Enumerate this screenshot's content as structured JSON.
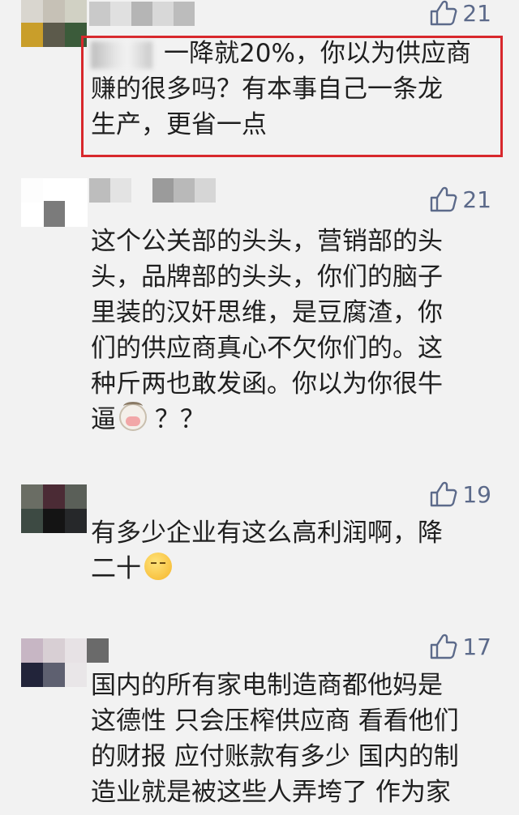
{
  "comments": [
    {
      "likes": "21",
      "lines": [
        "一降就20%，你以为供应商",
        "赚的很多吗？有本事自己一条龙",
        "生产，更省一点"
      ]
    },
    {
      "likes": "21",
      "lines": [
        "这个公关部的头头，营销部的头",
        "头，品牌部的头头，你们的脑子",
        "里装的汉奸思维，是豆腐渣，你",
        "们的供应商真心不欠你们的。这",
        "种斤两也敢发函。你以为你很牛",
        "逼",
        "？？"
      ]
    },
    {
      "likes": "19",
      "lines": [
        "有多少企业有这么高利润啊，降",
        "二十"
      ]
    },
    {
      "likes": "17",
      "lines": [
        "国内的所有家电制造商都他妈是",
        "这德性 只会压榨供应商 看看他们",
        "的财报 应付账款有多少 国内的制",
        "造业就是被这些人弄垮了 作为家"
      ]
    }
  ],
  "icons": {
    "like": "thumbs-up-icon",
    "cow": "cow-face-emoji",
    "sleepy": "sleepy-face-emoji"
  },
  "colors": {
    "highlight_border": "#d8282c",
    "like": "#5c6a8a",
    "text": "#1f1f1f",
    "background": "#f2f2f2"
  }
}
